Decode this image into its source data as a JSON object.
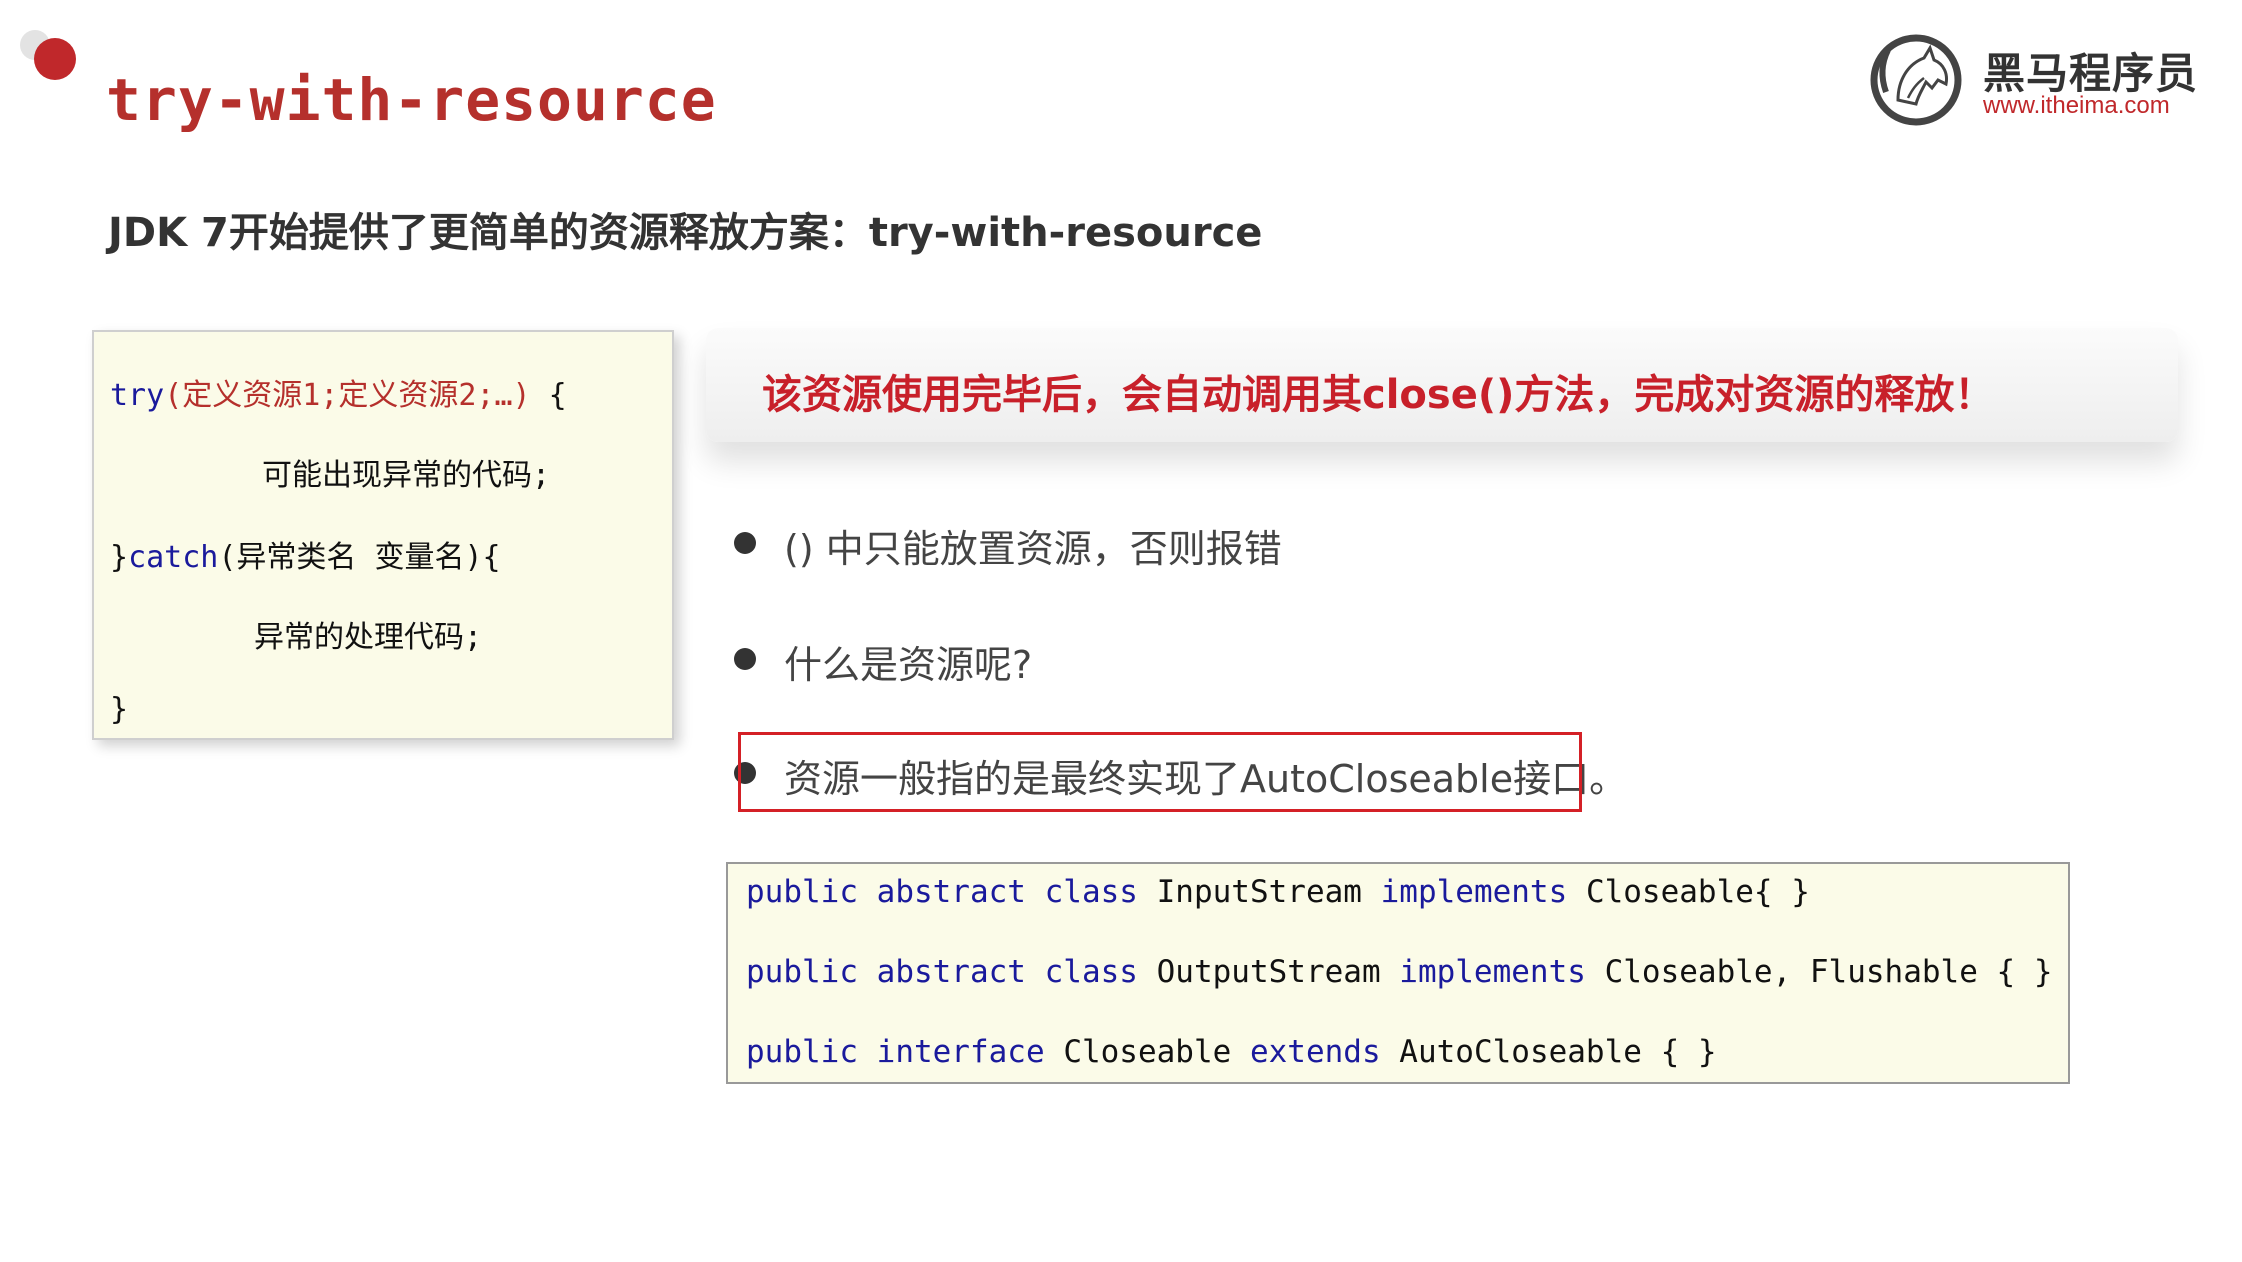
{
  "slide": {
    "title": "try-with-resource",
    "subtitle": "JDK 7开始提供了更简单的资源释放方案：try-with-resource"
  },
  "logo": {
    "icon": "horse-logo-icon",
    "name": "黑马程序员",
    "url": "www.itheima.com"
  },
  "syntax": {
    "line1_kw": "try",
    "line1_args": "(定义资源1;定义资源2;…)",
    "line1_end": " {",
    "line2": "可能出现异常的代码;",
    "line3_start": "}",
    "line3_kw": "catch",
    "line3_rest": "(异常类名 变量名){",
    "line4": "异常的处理代码;",
    "line5": "}"
  },
  "banner": {
    "text": "该资源使用完毕后，会自动调用其close()方法，完成对资源的释放！"
  },
  "bullets": [
    {
      "text": "() 中只能放置资源，否则报错"
    },
    {
      "text": "什么是资源呢?"
    },
    {
      "text": "资源一般指的是最终实现了AutoCloseable接口。"
    }
  ],
  "code": {
    "line1": {
      "k1": "public",
      "k2": "abstract",
      "k3": "class",
      "name": "InputStream",
      "k4": "implements",
      "rest": "Closeable{ }"
    },
    "line2": {
      "k1": "public",
      "k2": "abstract",
      "k3": "class",
      "name": "OutputStream",
      "k4": "implements",
      "rest": "Closeable, Flushable { }"
    },
    "line3": {
      "k1": "public",
      "k2": "interface",
      "name": "Closeable",
      "k3": "extends",
      "rest": "AutoCloseable { }"
    }
  },
  "colors": {
    "accent_red": "#c0282b",
    "keyword_blue": "#1a1a9c",
    "code_bg": "#fbfbe8"
  }
}
